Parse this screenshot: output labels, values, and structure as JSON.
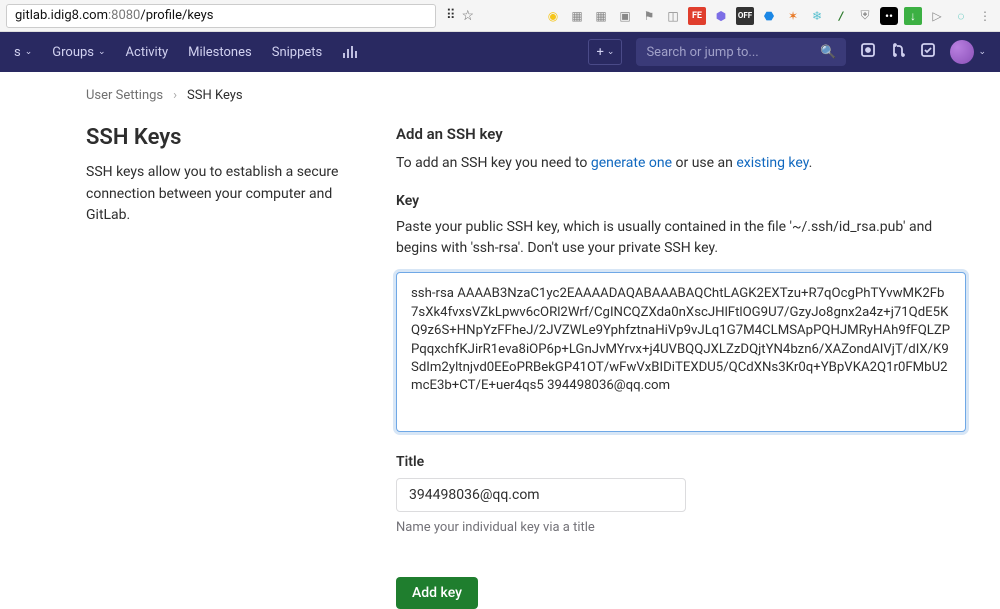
{
  "url": {
    "host": "gitlab.idig8.com",
    "port": ":8080",
    "path": "/profile/keys"
  },
  "nav": {
    "groups": "Groups",
    "activity": "Activity",
    "milestones": "Milestones",
    "snippets": "Snippets",
    "search_placeholder": "Search or jump to..."
  },
  "crumbs": {
    "parent": "User Settings",
    "current": "SSH Keys"
  },
  "left": {
    "title": "SSH Keys",
    "desc": "SSH keys allow you to establish a secure connection between your computer and GitLab."
  },
  "right": {
    "add_heading": "Add an SSH key",
    "hint_pre": "To add an SSH key you need to ",
    "hint_gen": "generate one",
    "hint_mid": " or use an ",
    "hint_exist": "existing key",
    "hint_post": ".",
    "key_label": "Key",
    "key_hint": "Paste your public SSH key, which is usually contained in the file '~/.ssh/id_rsa.pub' and begins with 'ssh-rsa'. Don't use your private SSH key.",
    "key_value": "ssh-rsa AAAAB3NzaC1yc2EAAAADAQABAAABAQChtLAGK2EXTzu+R7qOcgPhTYvwMK2Fb7sXk4fvxsVZkLpwv6cORl2Wrf/CgINCQZXda0nXscJHlFtlOG9U7/GzyJo8gnx2a4z+j71QdE5KQ9z6S+HNpYzFFheJ/2JVZWLe9YphfztnaHiVp9vJLq1G7M4CLMSApPQHJMRyHAh9fFQLZPPqqxchfKJirR1eva8iOP6p+LGnJvMYrvx+j4UVBQQJXLZzDQjtYN4bzn6/XAZondAIVjT/dIX/K9SdIm2yltnjvd0EEoPRBekGP41OT/wFwVxBIDiTEXDU5/QCdXNs3Kr0q+YBpVKA2Q1r0FMbU2mcE3b+CT/E+uer4qs5 394498036@qq.com",
    "title_label": "Title",
    "title_value": "394498036@qq.com",
    "title_hint": "Name your individual key via a title",
    "add_btn": "Add key"
  }
}
